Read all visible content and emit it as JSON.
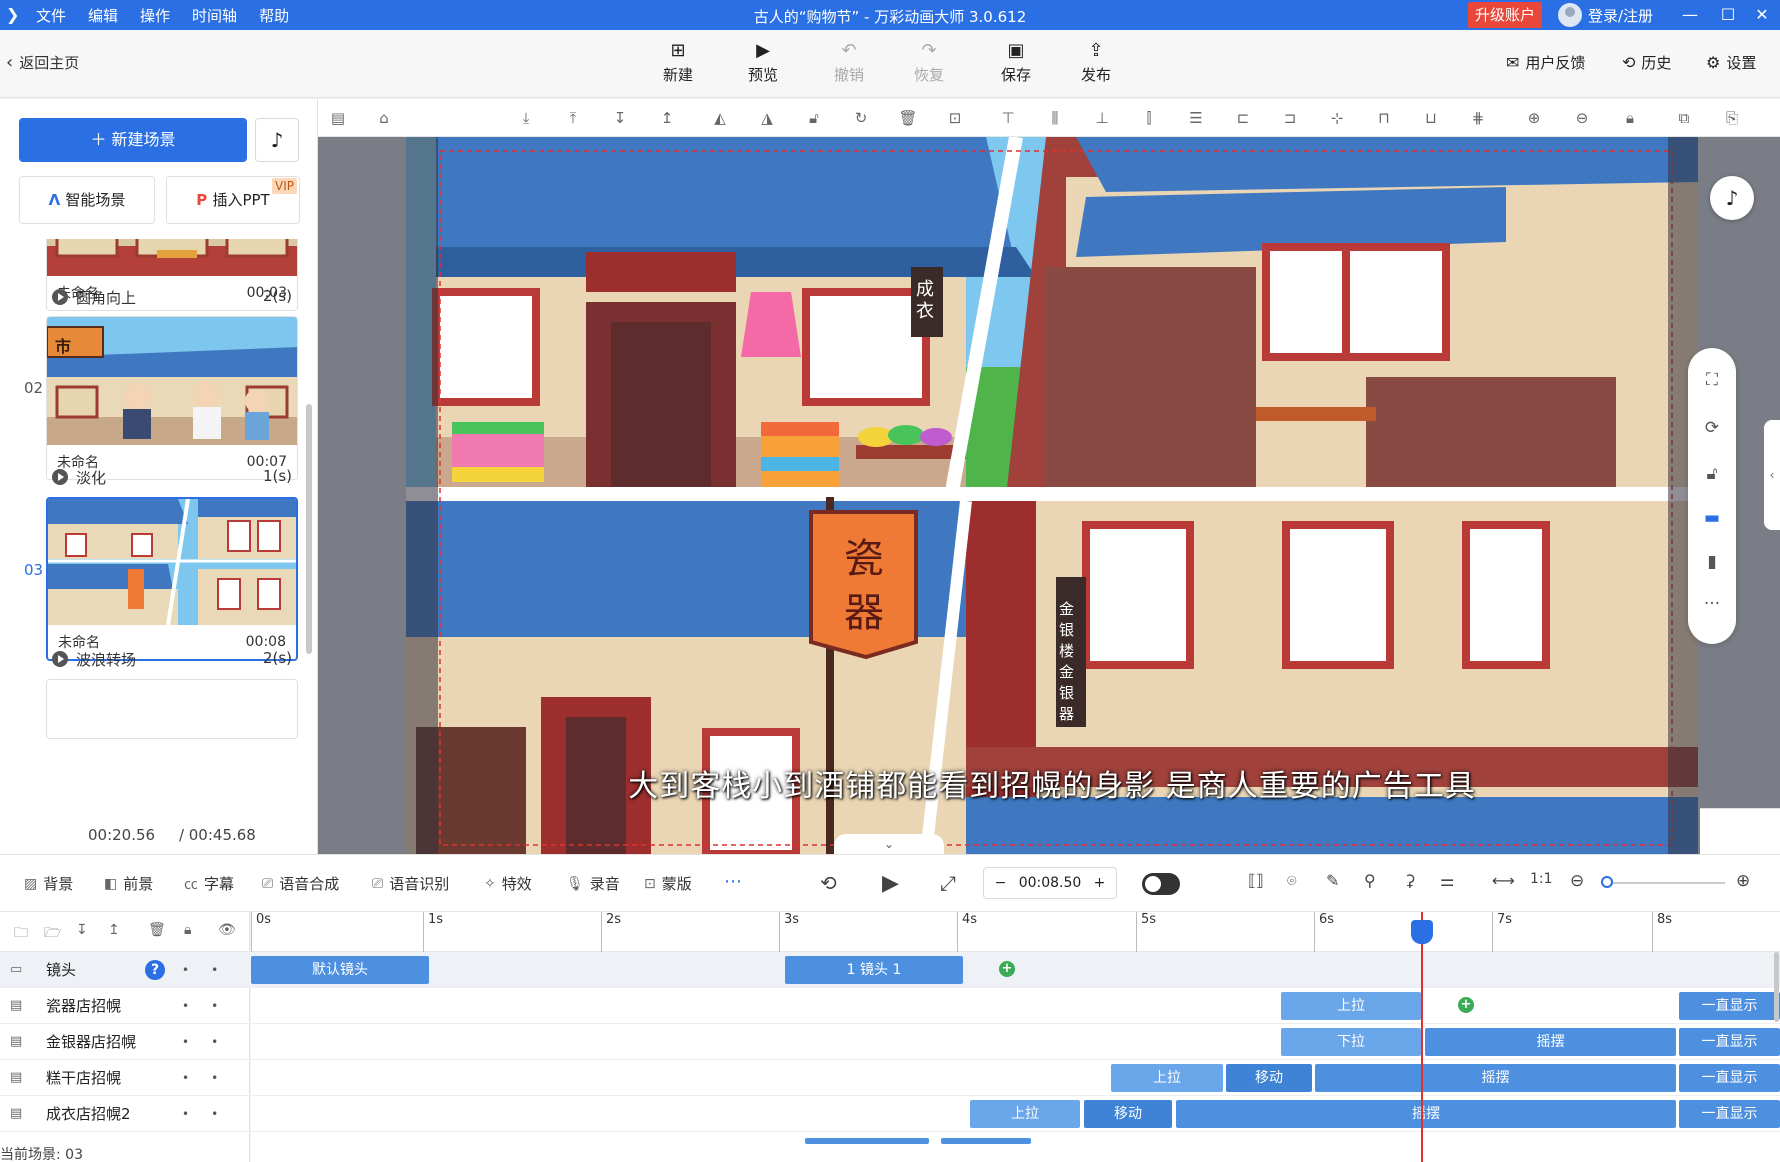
{
  "titlebar": {
    "menus": [
      "文件",
      "编辑",
      "操作",
      "时间轴",
      "帮助"
    ],
    "title": "古人的“购物节” - 万彩动画大师 3.0.612",
    "upgrade": "升级账户",
    "login": "登录/注册"
  },
  "toolbar": {
    "back": "返回主页",
    "new": "新建",
    "preview": "预览",
    "undo": "撤销",
    "redo": "恢复",
    "save": "保存",
    "publish": "发布",
    "feedback": "用户反馈",
    "history": "历史",
    "settings": "设置"
  },
  "left": {
    "new_scene": "新建场景",
    "smart_scene": "智能场景",
    "insert_ppt": "插入PPT",
    "vip": "VIP",
    "scenes": [
      {
        "no": "",
        "name": "未命名",
        "duration": "00:03",
        "transition": "圆角向上",
        "trans_dur": "2(s)"
      },
      {
        "no": "02",
        "name": "未命名",
        "duration": "00:07",
        "transition": "淡化",
        "trans_dur": "1(s)",
        "sign": "市"
      },
      {
        "no": "03",
        "name": "未命名",
        "duration": "00:08",
        "transition": "波浪转场",
        "trans_dur": "2(s)"
      }
    ],
    "time_current": "00:20.56",
    "time_total": "/ 00:45.68"
  },
  "stage": {
    "subtitle": "大到客栈小到酒铺都能看到招幌的身影 是商人重要的广告工具",
    "sign_cloth": "成衣",
    "sign_porcelain": "瓷器",
    "sign_gold": "金银楼金银器"
  },
  "timeline_toolbar": {
    "background": "背景",
    "foreground": "前景",
    "caption": "字幕",
    "tts": "语音合成",
    "asr": "语音识别",
    "effects": "特效",
    "record": "录音",
    "mask": "蒙版",
    "time": "00:08.50",
    "minus": "−",
    "plus": "+"
  },
  "timeline": {
    "ruler": [
      "0s",
      "1s",
      "2s",
      "3s",
      "4s",
      "5s",
      "6s",
      "7s",
      "8s"
    ],
    "tracks": [
      {
        "name": "镜头"
      },
      {
        "name": "瓷器店招幌"
      },
      {
        "name": "金银器店招幌"
      },
      {
        "name": "糕干店招幌"
      },
      {
        "name": "成衣店招幌2"
      }
    ],
    "clips": {
      "default_cam": "默认镜头",
      "cam1": "1 镜头 1",
      "pull_up": "上拉",
      "pull_down": "下拉",
      "move": "移动",
      "swing": "摇摆",
      "always": "一直显示"
    },
    "current_scene": "当前场景: 03"
  }
}
